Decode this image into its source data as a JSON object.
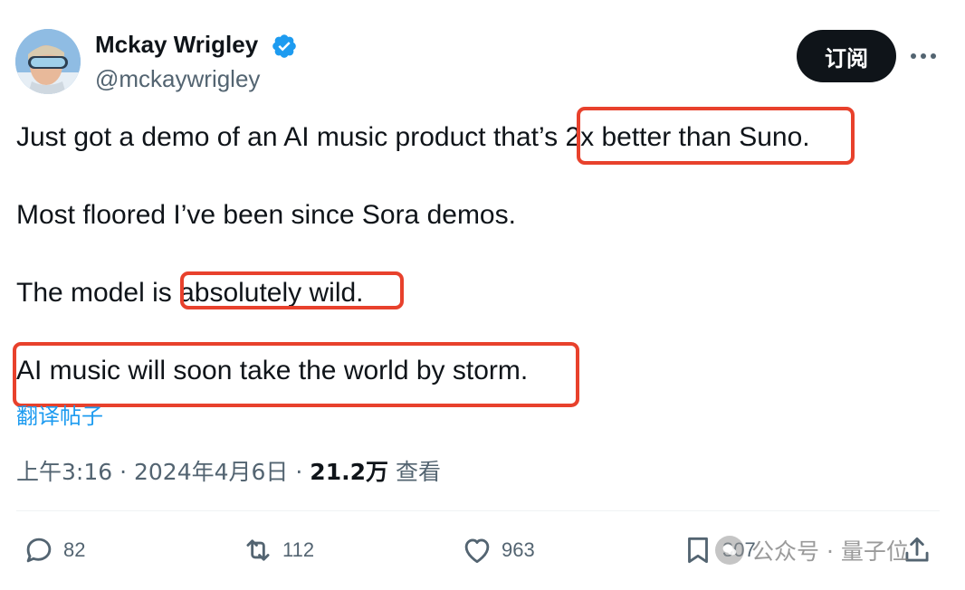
{
  "author": {
    "name": "Mckay Wrigley",
    "handle": "@mckaywrigley",
    "verified": true
  },
  "header": {
    "subscribe_label": "订阅",
    "more_icon": "more-horizontal-icon"
  },
  "tweet": {
    "lines": [
      "Just got a demo of an AI music product that’s 2x better than Suno.",
      "Most floored I’ve been since Sora demos.",
      "The model is absolutely wild.",
      "AI music will soon take the world by storm."
    ],
    "translate_label": "翻译帖子"
  },
  "meta": {
    "time": "上午3:16",
    "date": "2024年4月6日",
    "views": "21.2万",
    "views_label": "查看"
  },
  "actions": {
    "replies": "82",
    "retweets": "112",
    "likes": "963",
    "bookmarks": "307"
  },
  "watermark": {
    "text": "公众号 · 量子位"
  },
  "colors": {
    "highlight": "#e8412c",
    "link": "#1d9bf0",
    "verified": "#1d9bf0",
    "button_bg": "#0f1419",
    "muted_text": "#536471"
  }
}
